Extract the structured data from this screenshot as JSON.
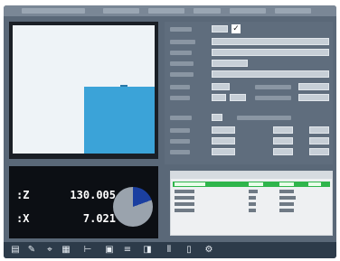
{
  "dro": {
    "z": {
      "axis": ":Z",
      "value": "130.005"
    },
    "x": {
      "axis": ":X",
      "value": "7.021"
    }
  },
  "toolbar": {
    "icons": [
      "ruler-icon",
      "pencil-icon",
      "tool-icon",
      "grid-icon",
      "caliper-icon",
      "window-icon",
      "stack-icon",
      "graph-icon",
      "chart-icon",
      "document-icon",
      "settings-icon"
    ]
  }
}
